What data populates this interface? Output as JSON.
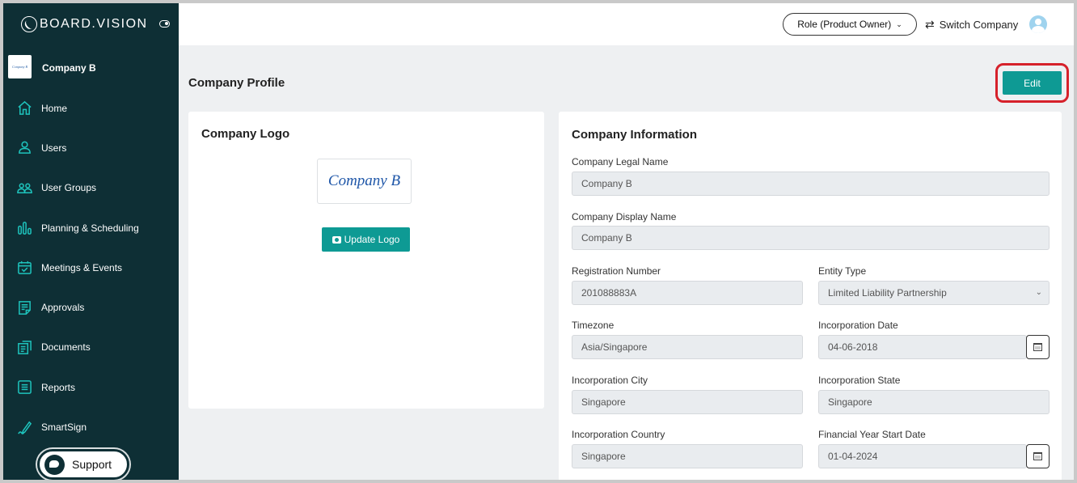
{
  "brand": {
    "name": "BOARD.VISION"
  },
  "sidebar": {
    "company": {
      "thumb_text": "Company B",
      "name": "Company B"
    },
    "items": [
      {
        "label": "Home",
        "icon": "home-icon"
      },
      {
        "label": "Users",
        "icon": "user-icon"
      },
      {
        "label": "User Groups",
        "icon": "user-group-icon"
      },
      {
        "label": "Planning & Scheduling",
        "icon": "bar-chart-icon"
      },
      {
        "label": "Meetings & Events",
        "icon": "calendar-check-icon"
      },
      {
        "label": "Approvals",
        "icon": "document-icon"
      },
      {
        "label": "Documents",
        "icon": "documents-icon"
      },
      {
        "label": "Reports",
        "icon": "report-icon"
      },
      {
        "label": "SmartSign",
        "icon": "pen-icon"
      }
    ],
    "support_label": "Support"
  },
  "topbar": {
    "role_label": "Role (Product Owner)",
    "switch_label": "Switch Company"
  },
  "main": {
    "title": "Company Profile",
    "edit_label": "Edit",
    "logo_card": {
      "title": "Company Logo",
      "logo_text": "Company B",
      "update_label": "Update Logo"
    },
    "info_card": {
      "title": "Company Information",
      "fields": {
        "legal_name": {
          "label": "Company Legal Name",
          "value": "Company B"
        },
        "display_name": {
          "label": "Company Display Name",
          "value": "Company B"
        },
        "registration_number": {
          "label": "Registration Number",
          "value": "201088883A"
        },
        "entity_type": {
          "label": "Entity Type",
          "value": "Limited Liability Partnership"
        },
        "timezone": {
          "label": "Timezone",
          "value": "Asia/Singapore"
        },
        "incorporation_date": {
          "label": "Incorporation Date",
          "value": "04-06-2018"
        },
        "incorporation_city": {
          "label": "Incorporation City",
          "value": "Singapore"
        },
        "incorporation_state": {
          "label": "Incorporation State",
          "value": "Singapore"
        },
        "incorporation_country": {
          "label": "Incorporation Country",
          "value": "Singapore"
        },
        "fy_start_date": {
          "label": "Financial Year Start Date",
          "value": "01-04-2024"
        }
      }
    }
  },
  "colors": {
    "sidebar": "#0e2f35",
    "accent": "#0e9a94",
    "highlight": "#d6212b"
  }
}
